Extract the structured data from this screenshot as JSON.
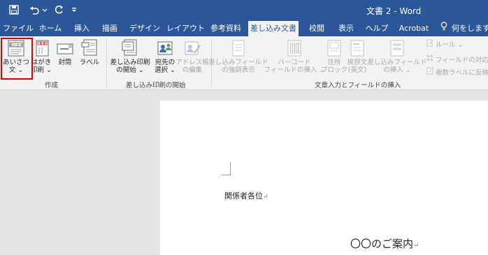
{
  "window": {
    "title": "文書 2 - Word"
  },
  "quick_access": {
    "save_icon": "save-icon",
    "undo_icon": "undo-icon",
    "redo_icon": "redo-icon",
    "customize_icon": "customize-qat-icon"
  },
  "tabs": [
    "ファイル",
    "ホーム",
    "挿入",
    "描画",
    "デザイン",
    "レイアウト",
    "参考資料",
    "差し込み文書",
    "校閲",
    "表示",
    "ヘルプ",
    "Acrobat"
  ],
  "active_tab": "差し込み文書",
  "tell_me": "何をしますか",
  "ribbon": {
    "create_group": {
      "label": "作成",
      "buttons": [
        {
          "line1": "あいさつ",
          "line2": "文 ⌄",
          "icon": "greeting-letter-icon"
        },
        {
          "line1": "はがき",
          "line2": "印刷 ⌄",
          "icon": "postcard-icon"
        },
        {
          "line1": "封筒",
          "line2": "",
          "icon": "envelope-icon"
        },
        {
          "line1": "ラベル",
          "line2": "",
          "icon": "label-icon"
        }
      ]
    },
    "start_group": {
      "label": "差し込み印刷の開始",
      "buttons": [
        {
          "line1": "差し込み印刷",
          "line2": "の開始 ⌄",
          "icon": "start-mail-merge-icon"
        },
        {
          "line1": "宛先の",
          "line2": "選択 ⌄",
          "icon": "select-recipients-icon"
        },
        {
          "line1": "アドレス帳",
          "line2": "の編集",
          "icon": "edit-address-book-icon"
        }
      ]
    },
    "write_group": {
      "label": "文章入力とフィールドの挿入",
      "buttons": [
        {
          "line1": "差し込みフィールド",
          "line2": "の強調表示",
          "icon": "highlight-fields-icon"
        },
        {
          "line1": "バーコード",
          "line2": "フィールドの挿入 ⌄",
          "icon": "barcode-icon"
        },
        {
          "line1": "住所",
          "line2": "ブロック",
          "icon": "address-block-icon"
        },
        {
          "line1": "挨拶文",
          "line2": "(英文)",
          "icon": "greeting-line-icon"
        },
        {
          "line1": "差し込みフィールド",
          "line2": "の挿入 ⌄",
          "icon": "insert-merge-field-icon"
        }
      ],
      "small_buttons": [
        "ルール ⌄",
        "フィールドの対応",
        "複数ラベルに反映"
      ]
    }
  },
  "document": {
    "recipient_line": "関係者各位",
    "heading": "〇〇のご案内",
    "paragraph_mark": "↵"
  },
  "colors": {
    "title_bar": "#2b579a",
    "ribbon_bg": "#f3f3f3",
    "highlight_border": "#e00000"
  }
}
